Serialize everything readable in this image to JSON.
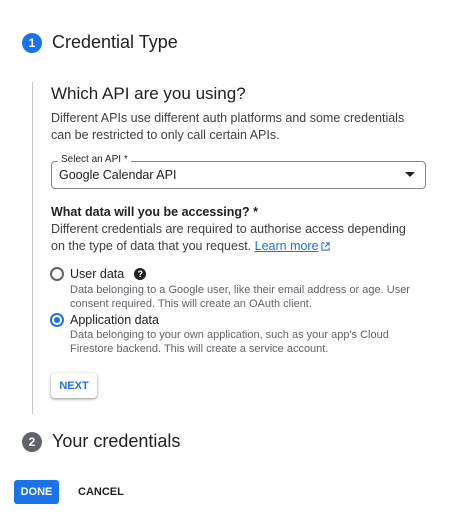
{
  "steps": [
    {
      "number": "1",
      "title": "Credential Type",
      "color": "#1a73e8"
    },
    {
      "number": "2",
      "title": "Your credentials",
      "color": "#5f6368"
    }
  ],
  "section": {
    "heading": "Which API are you using?",
    "description": "Different APIs use different auth platforms and some credentials can be restricted to only call certain APIs."
  },
  "api_select": {
    "label": "Select an API *",
    "value": "Google Calendar API",
    "caret_icon": "arrow-drop-down-icon"
  },
  "data_question": {
    "label": "What data will you be accessing? *",
    "description": "Different credentials are required to authorise access depending on the type of data that you request.",
    "link_text": "Learn more",
    "link_icon": "open-in-new-icon"
  },
  "options": [
    {
      "label": "User data",
      "checked": false,
      "help_icon": "help-icon",
      "help_symbol": "?",
      "description": "Data belonging to a Google user, like their email address or age. User consent required. This will create an OAuth client."
    },
    {
      "label": "Application data",
      "checked": true,
      "description": "Data belonging to your own application, such as your app's Cloud Firestore backend. This will create a service account."
    }
  ],
  "buttons": {
    "next": "NEXT",
    "done": "DONE",
    "cancel": "CANCEL"
  },
  "colors": {
    "accent": "#1a73e8",
    "inactive_step": "#5f6368"
  }
}
